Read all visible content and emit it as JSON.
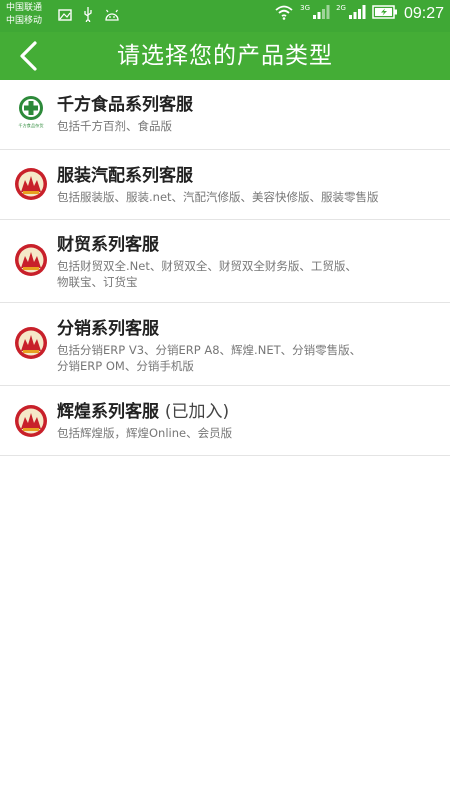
{
  "status_bar": {
    "carrier_top": "中国联通",
    "carrier_bottom": "中国移动",
    "net_1": "3G",
    "net_2": "2G",
    "time": "09:27"
  },
  "app_bar": {
    "title": "请选择您的产品类型"
  },
  "items": [
    {
      "title": "千方食品系列客服",
      "suffix": "",
      "desc_lines": [
        "包括千方百剂、食品版"
      ],
      "logo_text": "千方食品杂货"
    },
    {
      "title": "服装汽配系列客服",
      "suffix": "",
      "desc_lines": [
        "包括服装版、服装.net、汽配汽修版、美容快修版、服装零售版"
      ]
    },
    {
      "title": "财贸系列客服",
      "suffix": "",
      "desc_lines": [
        "包括财贸双全.Net、财贸双全、财贸双全财务版、工贸版、",
        "物联宝、订货宝"
      ]
    },
    {
      "title": "分销系列客服",
      "suffix": "",
      "desc_lines": [
        "包括分销ERP V3、分销ERP A8、辉煌.NET、分销零售版、",
        "分销ERP OM、分销手机版"
      ]
    },
    {
      "title": "辉煌系列客服",
      "suffix": "(已加入)",
      "desc_lines": [
        "包括辉煌版，辉煌Online、会员版"
      ]
    }
  ]
}
